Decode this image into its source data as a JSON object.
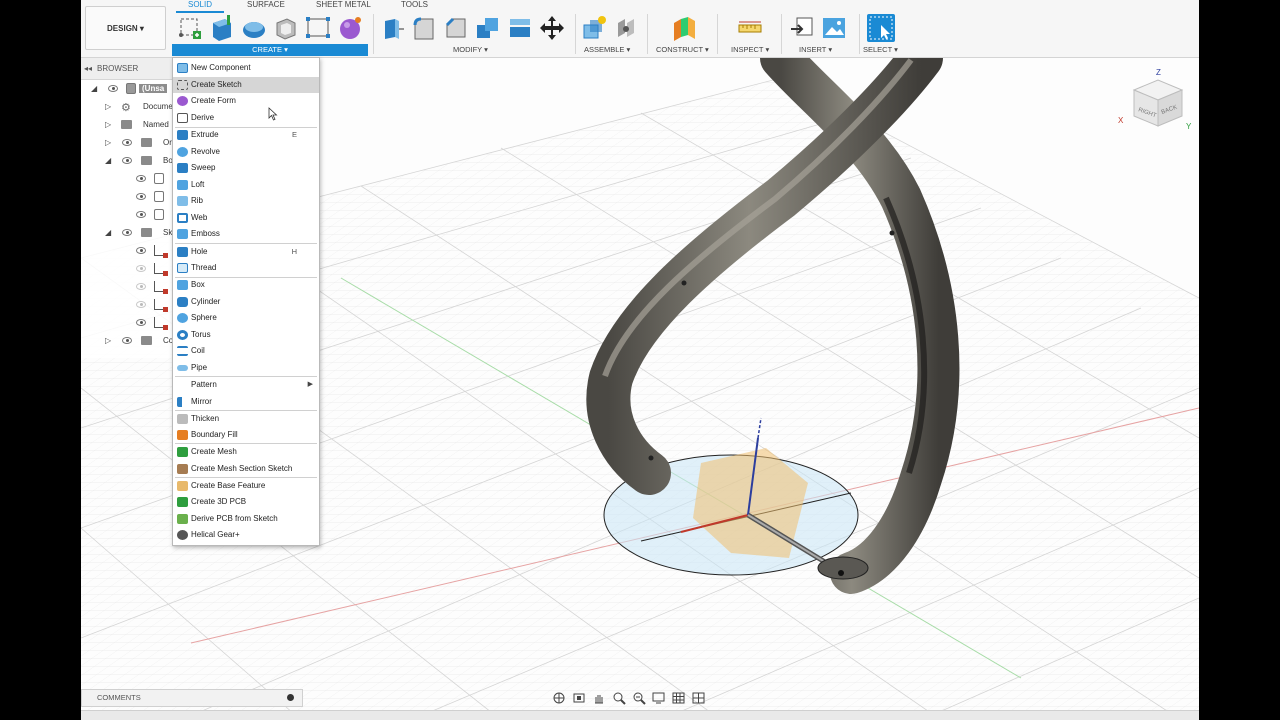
{
  "toolbar": {
    "workspace_button": "DESIGN ▾",
    "tabs": [
      "SOLID",
      "SURFACE",
      "SHEET METAL",
      "TOOLS"
    ],
    "groups": {
      "create": "CREATE ▾",
      "modify": "MODIFY ▾",
      "assemble": "ASSEMBLE ▾",
      "construct": "CONSTRUCT ▾",
      "inspect": "INSPECT ▾",
      "insert": "INSERT ▾",
      "select": "SELECT ▾"
    }
  },
  "browser": {
    "title": "BROWSER",
    "rows": [
      {
        "label": "(Unsa"
      },
      {
        "label": "Docume"
      },
      {
        "label": "Named"
      },
      {
        "label": "Or"
      },
      {
        "label": "Bo"
      },
      {
        "label": ""
      },
      {
        "label": ""
      },
      {
        "label": ""
      },
      {
        "label": "Sk"
      },
      {
        "label": ""
      },
      {
        "label": ""
      },
      {
        "label": ""
      },
      {
        "label": ""
      },
      {
        "label": ""
      },
      {
        "label": "Co"
      }
    ]
  },
  "create_menu": {
    "items": [
      {
        "label": "New Component",
        "shortcut": ""
      },
      {
        "label": "Create Sketch",
        "shortcut": ""
      },
      {
        "label": "Create Form",
        "shortcut": ""
      },
      {
        "label": "Derive",
        "shortcut": ""
      },
      {
        "label": "Extrude",
        "shortcut": "E"
      },
      {
        "label": "Revolve",
        "shortcut": ""
      },
      {
        "label": "Sweep",
        "shortcut": ""
      },
      {
        "label": "Loft",
        "shortcut": ""
      },
      {
        "label": "Rib",
        "shortcut": ""
      },
      {
        "label": "Web",
        "shortcut": ""
      },
      {
        "label": "Emboss",
        "shortcut": ""
      },
      {
        "label": "Hole",
        "shortcut": "H"
      },
      {
        "label": "Thread",
        "shortcut": ""
      },
      {
        "label": "Box",
        "shortcut": ""
      },
      {
        "label": "Cylinder",
        "shortcut": ""
      },
      {
        "label": "Sphere",
        "shortcut": ""
      },
      {
        "label": "Torus",
        "shortcut": ""
      },
      {
        "label": "Coil",
        "shortcut": ""
      },
      {
        "label": "Pipe",
        "shortcut": ""
      },
      {
        "label": "Pattern",
        "shortcut": ""
      },
      {
        "label": "Mirror",
        "shortcut": ""
      },
      {
        "label": "Thicken",
        "shortcut": ""
      },
      {
        "label": "Boundary Fill",
        "shortcut": ""
      },
      {
        "label": "Create Mesh",
        "shortcut": ""
      },
      {
        "label": "Create Mesh Section Sketch",
        "shortcut": ""
      },
      {
        "label": "Create Base Feature",
        "shortcut": ""
      },
      {
        "label": "Create 3D PCB",
        "shortcut": ""
      },
      {
        "label": "Derive PCB from Sketch",
        "shortcut": ""
      },
      {
        "label": "Helical Gear+",
        "shortcut": ""
      }
    ],
    "highlighted": "Create Sketch"
  },
  "viewcube": {
    "axis_x": "X",
    "axis_y": "Y",
    "axis_z": "Z",
    "face_right": "RIGHT",
    "face_back": "BACK"
  },
  "bottom": {
    "comments_label": "COMMENTS"
  },
  "colors": {
    "accent": "#1a8ad4",
    "tube": "#6e6b63",
    "sketch_plane": "#f0c070",
    "x_axis": "#c0392b",
    "z_axis": "#2c3e9e"
  }
}
